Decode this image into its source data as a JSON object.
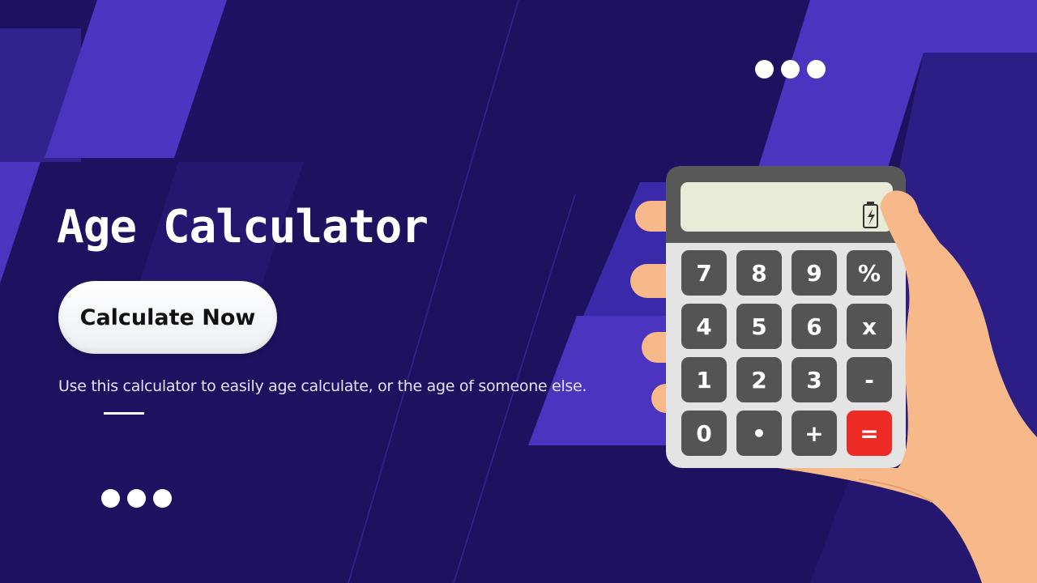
{
  "banner": {
    "title": "Age Calculator",
    "cta_label": "Calculate Now",
    "description": "Use this calculator to easily age calculate, or the age of someone else."
  },
  "calculator": {
    "keys": [
      {
        "label": "7",
        "icon": "digit-7-key"
      },
      {
        "label": "8",
        "icon": "digit-8-key"
      },
      {
        "label": "9",
        "icon": "digit-9-key"
      },
      {
        "label": "%",
        "icon": "percent-key"
      },
      {
        "label": "4",
        "icon": "digit-4-key"
      },
      {
        "label": "5",
        "icon": "digit-5-key"
      },
      {
        "label": "6",
        "icon": "digit-6-key"
      },
      {
        "label": "x",
        "icon": "multiply-key"
      },
      {
        "label": "1",
        "icon": "digit-1-key"
      },
      {
        "label": "2",
        "icon": "digit-2-key"
      },
      {
        "label": "3",
        "icon": "digit-3-key"
      },
      {
        "label": "-",
        "icon": "minus-key"
      },
      {
        "label": "0",
        "icon": "digit-0-key"
      },
      {
        "label": "•",
        "icon": "decimal-key"
      },
      {
        "label": "+",
        "icon": "plus-key"
      },
      {
        "label": "=",
        "icon": "equals-key"
      }
    ]
  },
  "colors": {
    "background": "#1e1260",
    "accent_purple": "#4a34c0",
    "equals_key": "#ee2a24",
    "key": "#545454",
    "calculator_body": "#e4e4e4",
    "display": "#e8ebd6",
    "skin": "#f8b98a"
  },
  "icons": [
    "dots-top-icon",
    "dots-bottom-icon",
    "battery-icon",
    "hand-holding-calculator-icon"
  ]
}
